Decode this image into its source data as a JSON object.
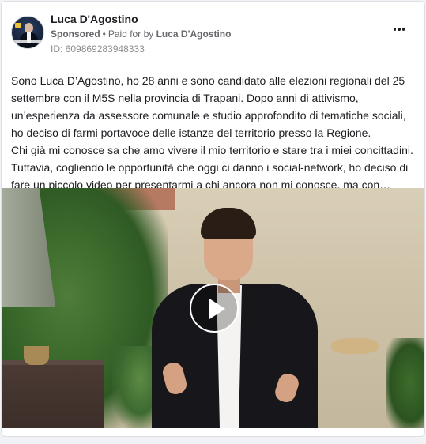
{
  "post": {
    "author": "Luca D'Agostino",
    "sponsored_label": "Sponsored",
    "separator": "•",
    "paid_for_prefix": "Paid for by",
    "paid_for_name": "Luca D'Agostino",
    "ad_id": "ID: 609869283948333",
    "more_icon": "more-horizontal-icon",
    "text_lines": [
      "Sono Luca D’Agostino, ho 28 anni e sono candidato alle elezioni regionali del 25",
      "settembre con il M5S nella provincia di Trapani. Dopo anni di attivismo,",
      "un’esperienza da assessore comunale e studio approfondito di tematiche sociali,",
      "ho deciso di farmi portavoce delle istanze del territorio presso la Regione.",
      "Chi già mi conosce sa che amo vivere il mio territorio e stare tra i miei concittadini.",
      "Tuttavia, cogliendo le opportunità che oggi ci danno i social-network, ho deciso di",
      "fare un piccolo video per presentarmi a chi ancora non mi conosce, ma con…"
    ],
    "video": {
      "play_icon": "play-icon"
    }
  }
}
